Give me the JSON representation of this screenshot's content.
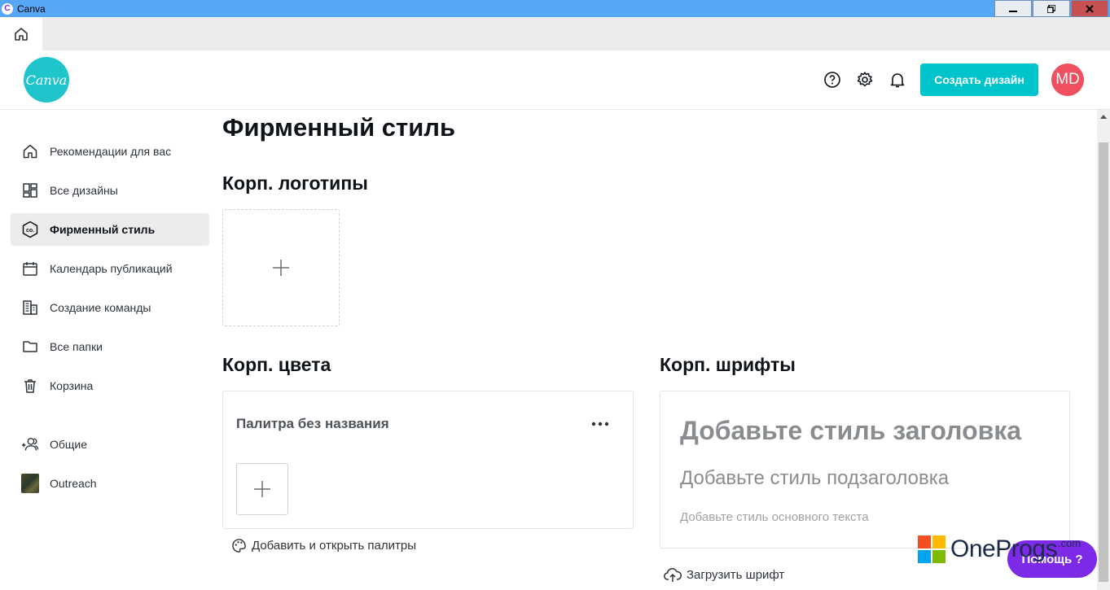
{
  "window": {
    "title": "Canva",
    "app_icon_letter": "C"
  },
  "header": {
    "logo_text": "Canva",
    "create_button": "Создать дизайн",
    "avatar_initials": "MD",
    "icons": [
      "help-icon",
      "gear-icon",
      "bell-icon"
    ]
  },
  "sidebar": {
    "items": [
      {
        "label": "Рекомендации для вас",
        "icon": "home-icon"
      },
      {
        "label": "Все дизайны",
        "icon": "grid-icon"
      },
      {
        "label": "Фирменный стиль",
        "icon": "brand-icon",
        "active": true
      },
      {
        "label": "Календарь публикаций",
        "icon": "calendar-icon"
      },
      {
        "label": "Создание команды",
        "icon": "building-icon"
      },
      {
        "label": "Все папки",
        "icon": "folder-icon"
      },
      {
        "label": "Корзина",
        "icon": "trash-icon"
      }
    ],
    "groups": [
      {
        "label": "Общие",
        "icon": "people-icon"
      },
      {
        "label": "Outreach",
        "icon": "team-thumbnail"
      }
    ]
  },
  "main": {
    "title": "Фирменный стиль",
    "logos": {
      "title": "Корп. логотипы"
    },
    "colors": {
      "title": "Корп. цвета",
      "palette_name": "Палитра без названия",
      "add_palette_link": "Добавить и открыть палитры"
    },
    "fonts": {
      "title": "Корп. шрифты",
      "heading_placeholder": "Добавьте стиль заголовка",
      "subheading_placeholder": "Добавьте стиль подзаголовка",
      "body_placeholder": "Добавьте стиль основного текста",
      "upload_link": "Загрузить шрифт"
    }
  },
  "help": {
    "label": "Помощь ?"
  },
  "watermark": {
    "text": "OneProgs",
    "suffix": ".com"
  },
  "colors": {
    "accent": "#00c4cc",
    "avatar": "#f04f5f",
    "help": "#7d2ae8",
    "titlebar": "#58a6f6"
  }
}
